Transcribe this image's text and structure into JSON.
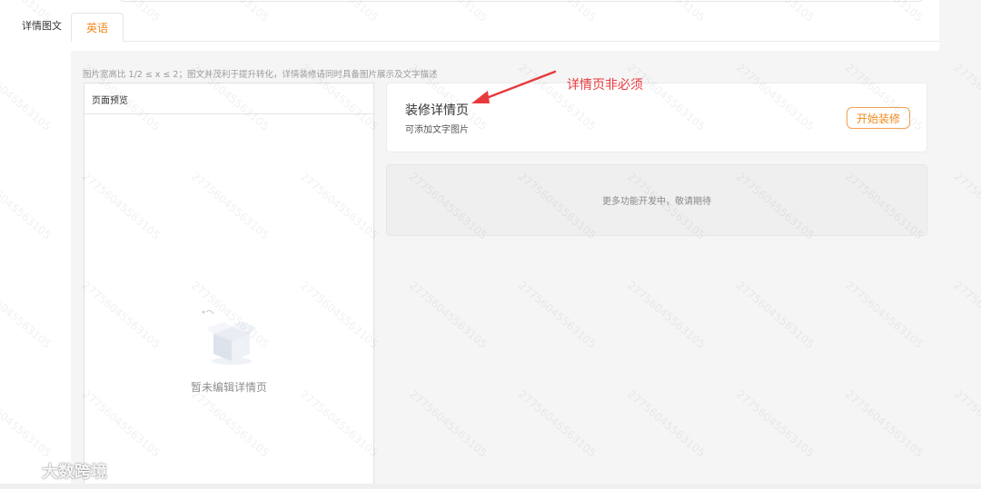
{
  "section": {
    "label": "详情图文"
  },
  "tabs": [
    {
      "label": "英语",
      "active": true
    }
  ],
  "hint": "图片宽高比 1/2 ≤ x ≤ 2；图文并茂利于提升转化，详情装修请同时具备图片展示及文字描述",
  "preview": {
    "header": "页面预览",
    "empty_text": "暂未编辑详情页"
  },
  "decor_card": {
    "title": "装修详情页",
    "subtitle": "可添加文字图片",
    "button_label": "开始装修"
  },
  "more_features": "更多功能开发中，敬请期待",
  "annotation": "详情页非必须",
  "watermark": "27756045563105",
  "brand": {
    "name": "大数跨境"
  },
  "colors": {
    "accent": "#f08a1c",
    "annotation": "#e8393d",
    "panel_bg": "#f5f5f5"
  }
}
